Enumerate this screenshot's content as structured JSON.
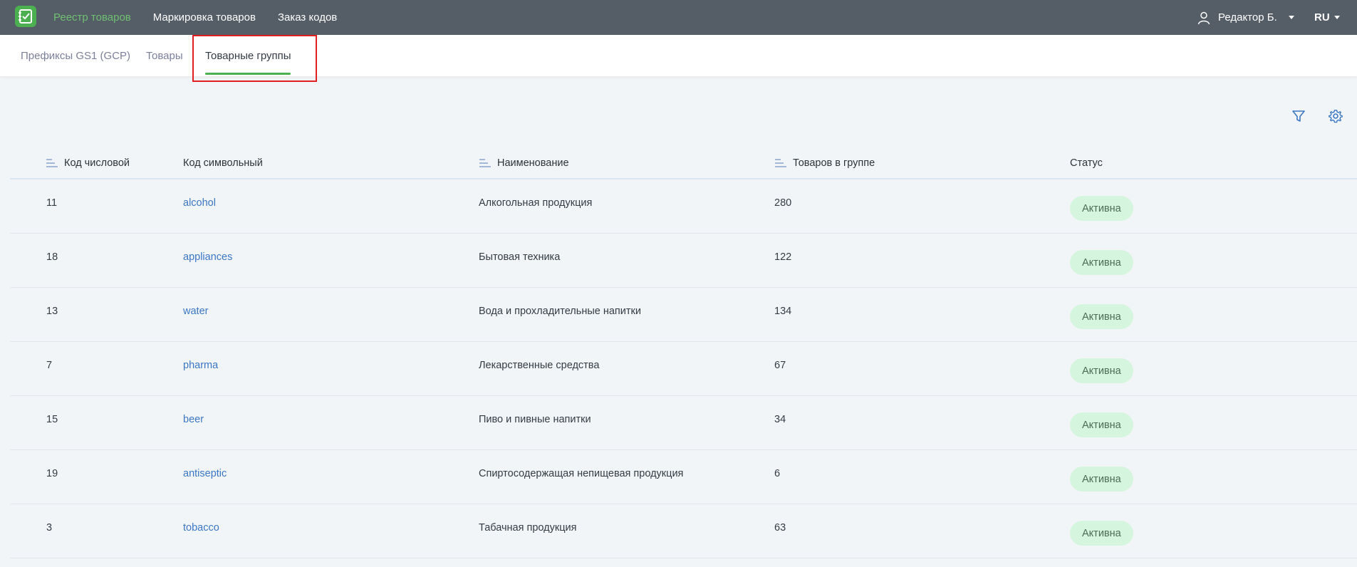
{
  "topbar": {
    "nav": [
      {
        "label": "Реестр товаров",
        "active": true
      },
      {
        "label": "Маркировка товаров",
        "active": false
      },
      {
        "label": "Заказ кодов",
        "active": false
      }
    ],
    "user_label": "Редактор Б.",
    "lang": "RU"
  },
  "tabs": [
    {
      "label": "Префиксы GS1 (GCP)"
    },
    {
      "label": "Товары"
    },
    {
      "label": "Товарные группы"
    }
  ],
  "table": {
    "columns": [
      "Код числовой",
      "Код символьный",
      "Наименование",
      "Товаров в группе",
      "Статус"
    ],
    "rows": [
      {
        "num": "11",
        "code": "alcohol",
        "name": "Алкогольная продукция",
        "count": "280",
        "status": "Активна"
      },
      {
        "num": "18",
        "code": "appliances",
        "name": "Бытовая техника",
        "count": "122",
        "status": "Активна"
      },
      {
        "num": "13",
        "code": "water",
        "name": "Вода и прохладительные напитки",
        "count": "134",
        "status": "Активна"
      },
      {
        "num": "7",
        "code": "pharma",
        "name": "Лекарственные средства",
        "count": "67",
        "status": "Активна"
      },
      {
        "num": "15",
        "code": "beer",
        "name": "Пиво и пивные напитки",
        "count": "34",
        "status": "Активна"
      },
      {
        "num": "19",
        "code": "antiseptic",
        "name": "Спиртосодержащая непищевая продукция",
        "count": "6",
        "status": "Активна"
      },
      {
        "num": "3",
        "code": "tobacco",
        "name": "Табачная продукция",
        "count": "63",
        "status": "Активна"
      }
    ]
  },
  "colors": {
    "topbar": "#555d66",
    "accent": "#4caf50",
    "link": "#3b77c4",
    "badge_bg": "#d6f5de"
  }
}
